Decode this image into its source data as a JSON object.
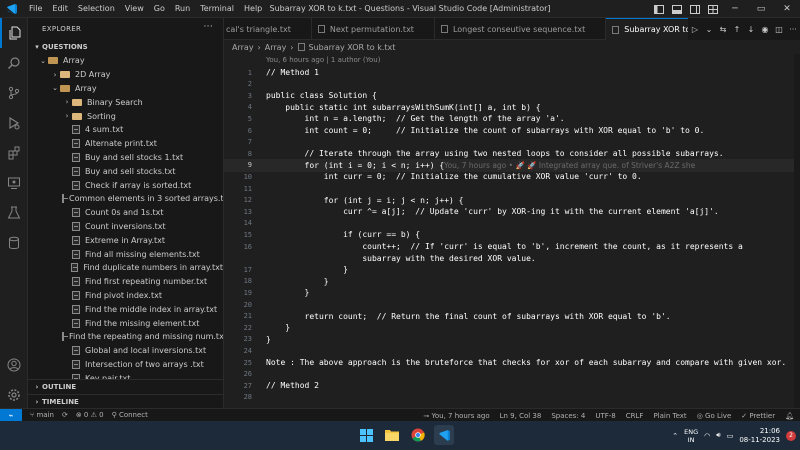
{
  "titlebar": {
    "menu": [
      "File",
      "Edit",
      "Selection",
      "View",
      "Go",
      "Run",
      "Terminal",
      "Help"
    ],
    "window_title": "Subarray XOR to k.txt - Questions - Visual Studio Code [Administrator]"
  },
  "sidebar": {
    "header": "EXPLORER",
    "section_title": "QUESTIONS",
    "tree": [
      {
        "label": "Array",
        "type": "folder",
        "depth": 0,
        "expanded": true
      },
      {
        "label": "2D Array",
        "type": "folder",
        "depth": 1,
        "expanded": false
      },
      {
        "label": "Array",
        "type": "folder",
        "depth": 1,
        "expanded": true
      },
      {
        "label": "Binary Search",
        "type": "folder",
        "depth": 2,
        "expanded": false
      },
      {
        "label": "Sorting",
        "type": "folder",
        "depth": 2,
        "expanded": false
      },
      {
        "label": "4 sum.txt",
        "type": "file",
        "depth": 2
      },
      {
        "label": "Alternate print.txt",
        "type": "file",
        "depth": 2
      },
      {
        "label": "Buy and sell stocks 1.txt",
        "type": "file",
        "depth": 2
      },
      {
        "label": "Buy and sell stocks.txt",
        "type": "file",
        "depth": 2
      },
      {
        "label": "Check if array is sorted.txt",
        "type": "file",
        "depth": 2
      },
      {
        "label": "Common elements in 3 sorted arrays.txt",
        "type": "file",
        "depth": 2
      },
      {
        "label": "Count 0s and 1s.txt",
        "type": "file",
        "depth": 2
      },
      {
        "label": "Count inversions.txt",
        "type": "file",
        "depth": 2
      },
      {
        "label": "Extreme in Array.txt",
        "type": "file",
        "depth": 2
      },
      {
        "label": "Find all missing elements.txt",
        "type": "file",
        "depth": 2
      },
      {
        "label": "Find duplicate numbers in array.txt",
        "type": "file",
        "depth": 2
      },
      {
        "label": "Find first repeating number.txt",
        "type": "file",
        "depth": 2
      },
      {
        "label": "Find pivot index.txt",
        "type": "file",
        "depth": 2
      },
      {
        "label": "Find the middle index in array.txt",
        "type": "file",
        "depth": 2
      },
      {
        "label": "Find the missing element.txt",
        "type": "file",
        "depth": 2
      },
      {
        "label": "Find the repeating and missing num.txt",
        "type": "file",
        "depth": 2
      },
      {
        "label": "Global and local inversions.txt",
        "type": "file",
        "depth": 2
      },
      {
        "label": "Intersection of two arrays .txt",
        "type": "file",
        "depth": 2
      },
      {
        "label": "Key pair.txt",
        "type": "file",
        "depth": 2
      }
    ],
    "outline": "OUTLINE",
    "timeline": "TIMELINE"
  },
  "tabs": [
    {
      "label": "cal's triangle.txt",
      "active": false
    },
    {
      "label": "Next permutation.txt",
      "active": false
    },
    {
      "label": "Longest conseutive sequence.txt",
      "active": false
    },
    {
      "label": "Subarray XOR to k.txt",
      "active": true
    }
  ],
  "breadcrumb": [
    "Array",
    "Array",
    "Subarray XOR to k.txt"
  ],
  "editor": {
    "codelens": "You, 6 hours ago | 1 author (You)",
    "current_line": 9,
    "blame": "You, 7 hours ago • 🚀 🚀 Integrated array que. of Striver's A2Z she",
    "lines": [
      {
        "n": 1,
        "text": "// Method 1"
      },
      {
        "n": 2,
        "text": ""
      },
      {
        "n": 3,
        "text": "public class Solution {"
      },
      {
        "n": 4,
        "text": "    public static int subarraysWithSumK(int[] a, int b) {"
      },
      {
        "n": 5,
        "text": "        int n = a.length;  // Get the length of the array 'a'."
      },
      {
        "n": 6,
        "text": "        int count = 0;     // Initialize the count of subarrays with XOR equal to 'b' to 0."
      },
      {
        "n": 7,
        "text": ""
      },
      {
        "n": 8,
        "text": "        // Iterate through the array using two nested loops to consider all possible subarrays."
      },
      {
        "n": 9,
        "text": "        for (int i = 0; i < n; i++) {"
      },
      {
        "n": 10,
        "text": "            int curr = 0;  // Initialize the cumulative XOR value 'curr' to 0."
      },
      {
        "n": 11,
        "text": ""
      },
      {
        "n": 12,
        "text": "            for (int j = i; j < n; j++) {"
      },
      {
        "n": 13,
        "text": "                curr ^= a[j];  // Update 'curr' by XOR-ing it with the current element 'a[j]'."
      },
      {
        "n": 14,
        "text": ""
      },
      {
        "n": 15,
        "text": "                if (curr == b) {"
      },
      {
        "n": 16,
        "text": "                    count++;  // If 'curr' is equal to 'b', increment the count, as it represents a"
      },
      {
        "n": "",
        "text": "                    subarray with the desired XOR value."
      },
      {
        "n": 17,
        "text": "                }"
      },
      {
        "n": 18,
        "text": "            }"
      },
      {
        "n": 19,
        "text": "        }"
      },
      {
        "n": 20,
        "text": ""
      },
      {
        "n": 21,
        "text": "        return count;  // Return the final count of subarrays with XOR equal to 'b'."
      },
      {
        "n": 22,
        "text": "    }"
      },
      {
        "n": 23,
        "text": "}"
      },
      {
        "n": 24,
        "text": ""
      },
      {
        "n": 25,
        "text": "Note : The above approach is the bruteforce that checks for xor of each subarray and compare with given xor."
      },
      {
        "n": 26,
        "text": ""
      },
      {
        "n": 27,
        "text": "// Method 2"
      },
      {
        "n": 28,
        "text": ""
      }
    ]
  },
  "statusbar": {
    "branch": "main",
    "sync": "⟳",
    "errors": "0",
    "warnings": "0",
    "connect": "Connect",
    "blame": "You, 7 hours ago",
    "position": "Ln 9, Col 38",
    "spaces": "Spaces: 4",
    "encoding": "UTF-8",
    "eol": "CRLF",
    "language": "Plain Text",
    "golive": "Go Live",
    "prettier": "Prettier"
  },
  "taskbar": {
    "lang_top": "ENG",
    "lang_bottom": "IN",
    "time": "21:06",
    "date": "08-11-2023",
    "notifications": "2"
  },
  "colors": {
    "accent": "#0078d4",
    "keyword": "#569cd6",
    "comment": "#6a9955",
    "folder": "#dcb67a"
  }
}
